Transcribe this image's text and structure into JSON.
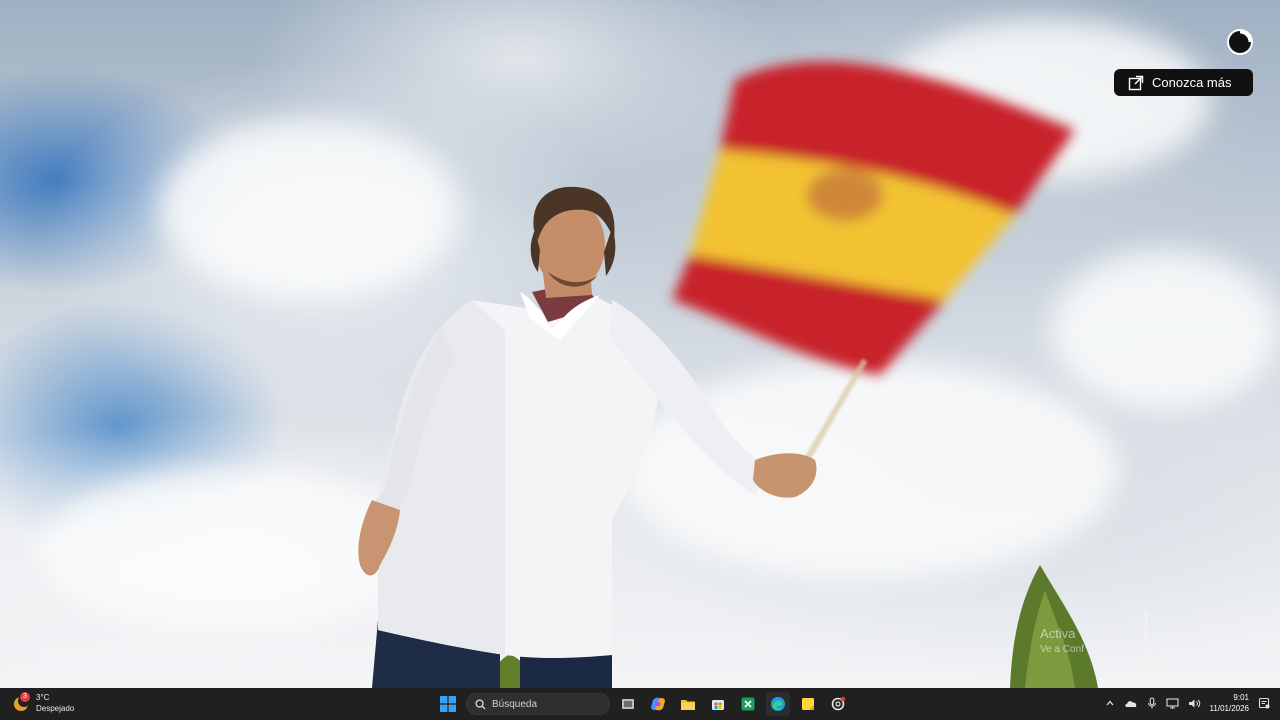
{
  "video": {
    "learn_more_label": "Conozca más",
    "watermark_line1": "Activa",
    "watermark_line2": "Ve a Conf"
  },
  "taskbar": {
    "weather": {
      "badge": "3",
      "temp": "3°C",
      "condition": "Despejado"
    },
    "search_placeholder": "Búsqueda",
    "apps": [
      "windows-start",
      "task-view",
      "copilot",
      "file-explorer",
      "microsoft-store",
      "spreadsheet-app",
      "edge-browser",
      "sticky-notes",
      "chatgpt"
    ],
    "clock": {
      "time": "9:01",
      "date": "11/01/2026"
    }
  },
  "colors": {
    "taskbar_bg": "#202020",
    "flag_red": "#c8202a",
    "flag_yellow": "#f2c230",
    "overlay_button_bg": "#111111"
  }
}
